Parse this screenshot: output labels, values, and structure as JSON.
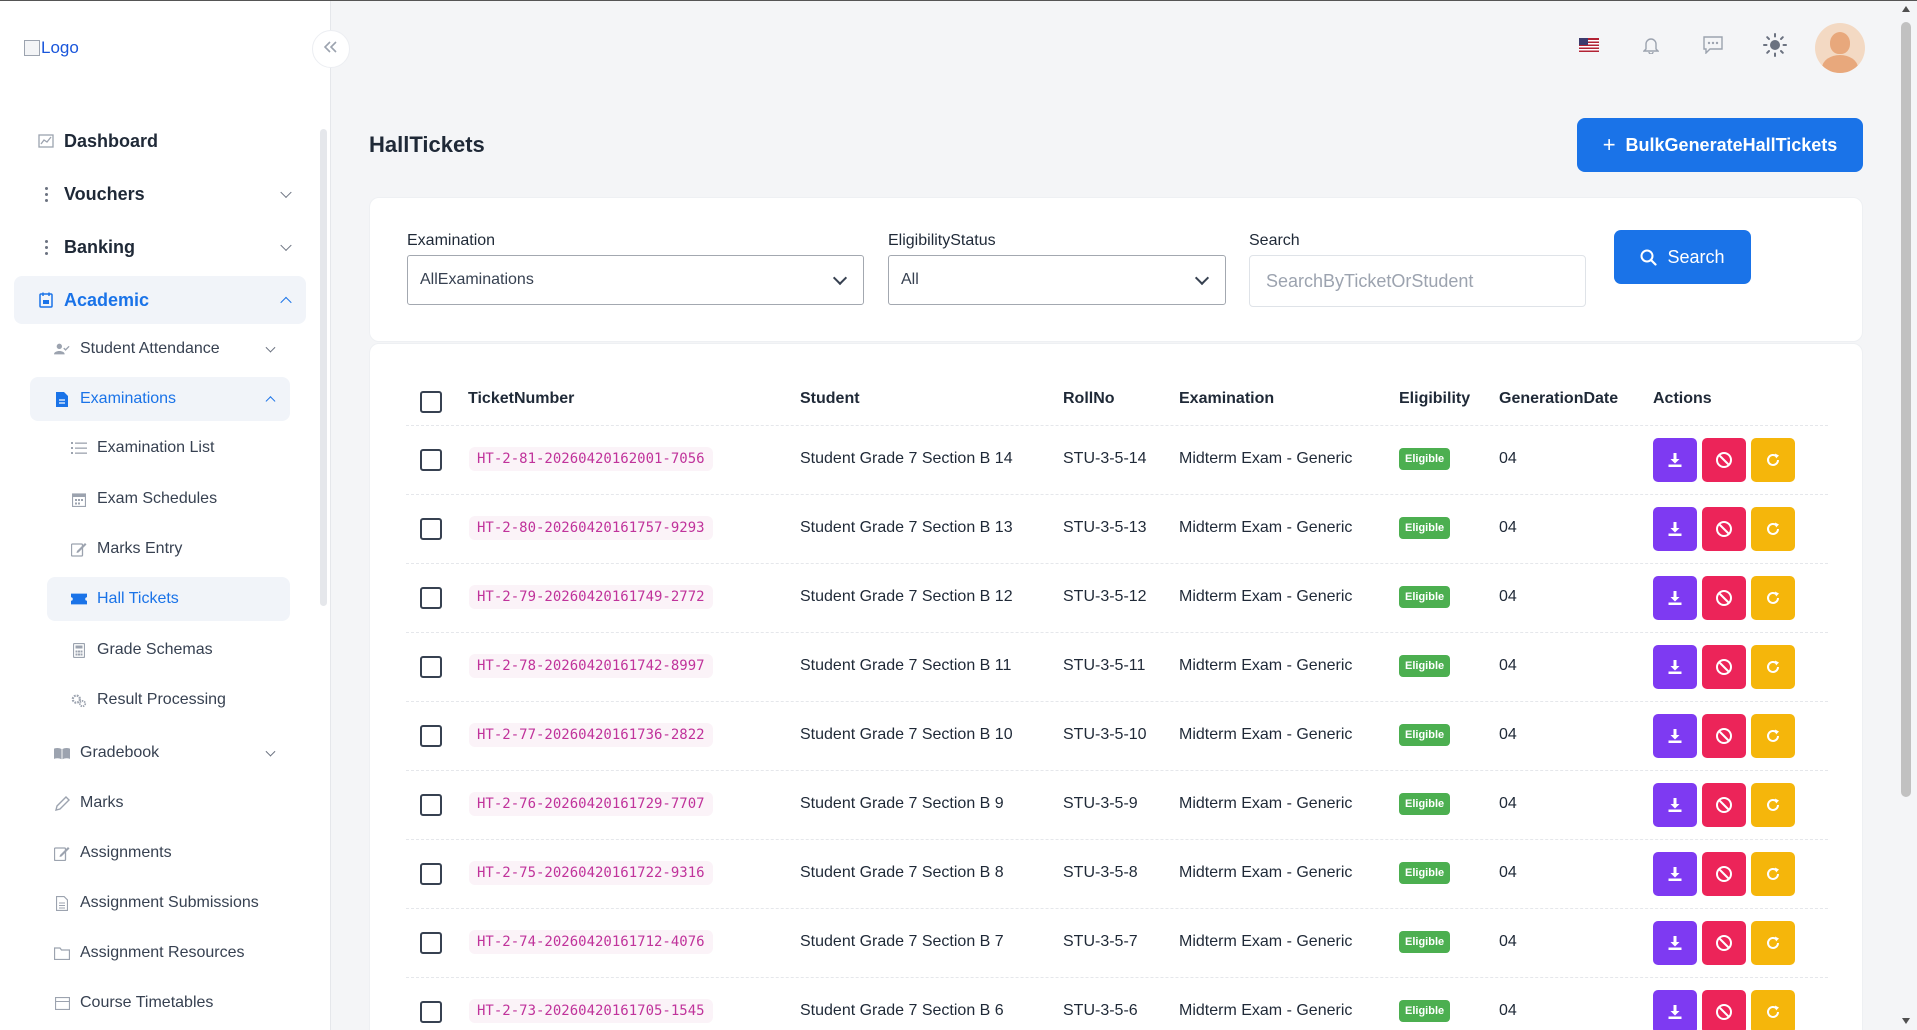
{
  "logo": {
    "alt": "Logo"
  },
  "sidebar": {
    "main": [
      {
        "label": "Dashboard"
      },
      {
        "label": "Vouchers"
      },
      {
        "label": "Banking"
      },
      {
        "label": "Academic"
      }
    ],
    "academic": [
      {
        "label": "Student Attendance"
      },
      {
        "label": "Examinations"
      }
    ],
    "examinations": [
      {
        "label": "Examination List"
      },
      {
        "label": "Exam Schedules"
      },
      {
        "label": "Marks Entry"
      },
      {
        "label": "Hall Tickets"
      },
      {
        "label": "Grade Schemas"
      },
      {
        "label": "Result Processing"
      }
    ],
    "more": [
      {
        "label": "Gradebook"
      },
      {
        "label": "Marks"
      },
      {
        "label": "Assignments"
      },
      {
        "label": "Assignment Submissions"
      },
      {
        "label": "Assignment Resources"
      },
      {
        "label": "Course Timetables"
      }
    ]
  },
  "page": {
    "title": "HallTickets",
    "bulk_button": "BulkGenerateHallTickets"
  },
  "filters": {
    "examination_label": "Examination",
    "examination_value": "AllExaminations",
    "eligibility_label": "EligibilityStatus",
    "eligibility_value": "All",
    "search_label": "Search",
    "search_placeholder": "SearchByTicketOrStudent",
    "search_button": "Search"
  },
  "table": {
    "headers": [
      "TicketNumber",
      "Student",
      "RollNo",
      "Examination",
      "Eligibility",
      "GenerationDate",
      "Actions"
    ],
    "rows": [
      {
        "ticket": "HT-2-81-20260420162001-7056",
        "student": "Student Grade 7 Section B 14",
        "roll": "STU-3-5-14",
        "exam": "Midterm Exam - Generic",
        "eligibility": "Eligible",
        "date": "04"
      },
      {
        "ticket": "HT-2-80-20260420161757-9293",
        "student": "Student Grade 7 Section B 13",
        "roll": "STU-3-5-13",
        "exam": "Midterm Exam - Generic",
        "eligibility": "Eligible",
        "date": "04"
      },
      {
        "ticket": "HT-2-79-20260420161749-2772",
        "student": "Student Grade 7 Section B 12",
        "roll": "STU-3-5-12",
        "exam": "Midterm Exam - Generic",
        "eligibility": "Eligible",
        "date": "04"
      },
      {
        "ticket": "HT-2-78-20260420161742-8997",
        "student": "Student Grade 7 Section B 11",
        "roll": "STU-3-5-11",
        "exam": "Midterm Exam - Generic",
        "eligibility": "Eligible",
        "date": "04"
      },
      {
        "ticket": "HT-2-77-20260420161736-2822",
        "student": "Student Grade 7 Section B 10",
        "roll": "STU-3-5-10",
        "exam": "Midterm Exam - Generic",
        "eligibility": "Eligible",
        "date": "04"
      },
      {
        "ticket": "HT-2-76-20260420161729-7707",
        "student": "Student Grade 7 Section B 9",
        "roll": "STU-3-5-9",
        "exam": "Midterm Exam - Generic",
        "eligibility": "Eligible",
        "date": "04"
      },
      {
        "ticket": "HT-2-75-20260420161722-9316",
        "student": "Student Grade 7 Section B 8",
        "roll": "STU-3-5-8",
        "exam": "Midterm Exam - Generic",
        "eligibility": "Eligible",
        "date": "04"
      },
      {
        "ticket": "HT-2-74-20260420161712-4076",
        "student": "Student Grade 7 Section B 7",
        "roll": "STU-3-5-7",
        "exam": "Midterm Exam - Generic",
        "eligibility": "Eligible",
        "date": "04"
      },
      {
        "ticket": "HT-2-73-20260420161705-1545",
        "student": "Student Grade 7 Section B 6",
        "roll": "STU-3-5-6",
        "exam": "Midterm Exam - Generic",
        "eligibility": "Eligible",
        "date": "04"
      }
    ]
  },
  "colors": {
    "primary": "#1a73e8",
    "download": "#7e3af2",
    "revoke": "#ec2459",
    "regenerate": "#f5b60b",
    "eligible": "#4caf50",
    "ticket_text": "#c0339b"
  },
  "icons": {
    "header": [
      "us-flag-icon",
      "bell-icon",
      "chat-icon",
      "sun-icon"
    ],
    "actions": [
      "download-icon",
      "ban-icon",
      "refresh-icon"
    ]
  }
}
